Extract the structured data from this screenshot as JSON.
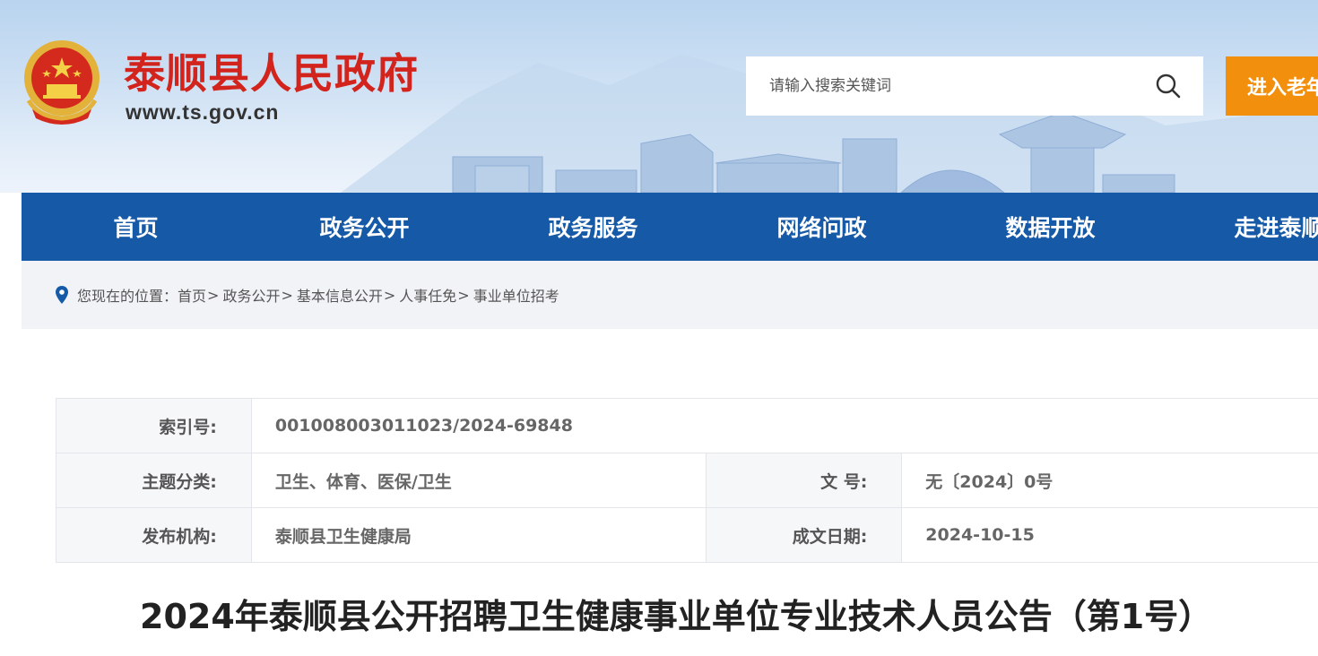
{
  "header": {
    "site_title": "泰顺县人民政府",
    "site_url": "www.ts.gov.cn",
    "search_placeholder": "请输入搜索关键词",
    "elder_mode_label": "进入老年"
  },
  "nav": {
    "items": [
      {
        "label": "首页"
      },
      {
        "label": "政务公开"
      },
      {
        "label": "政务服务"
      },
      {
        "label": "网络问政"
      },
      {
        "label": "数据开放"
      },
      {
        "label": "走进泰顺"
      }
    ]
  },
  "breadcrumb": {
    "prefix": "您现在的位置：",
    "items": [
      "首页",
      "政务公开",
      "基本信息公开",
      "人事任免",
      "事业单位招考"
    ],
    "separator": ">"
  },
  "meta": {
    "index_label": "索引号:",
    "index_value": "001008003011023/2024-69848",
    "topic_label": "主题分类:",
    "topic_value": "卫生、体育、医保/卫生",
    "docno_label": "文 号:",
    "docno_value": "无〔2024〕0号",
    "org_label": "发布机构:",
    "org_value": "泰顺县卫生健康局",
    "date_label": "成文日期:",
    "date_value": "2024-10-15"
  },
  "article": {
    "title": "2024年泰顺县公开招聘卫生健康事业单位专业技术人员公告（第1号）"
  },
  "colors": {
    "nav_blue": "#1559a7",
    "title_red": "#d2231c",
    "elder_orange": "#f2900e"
  }
}
